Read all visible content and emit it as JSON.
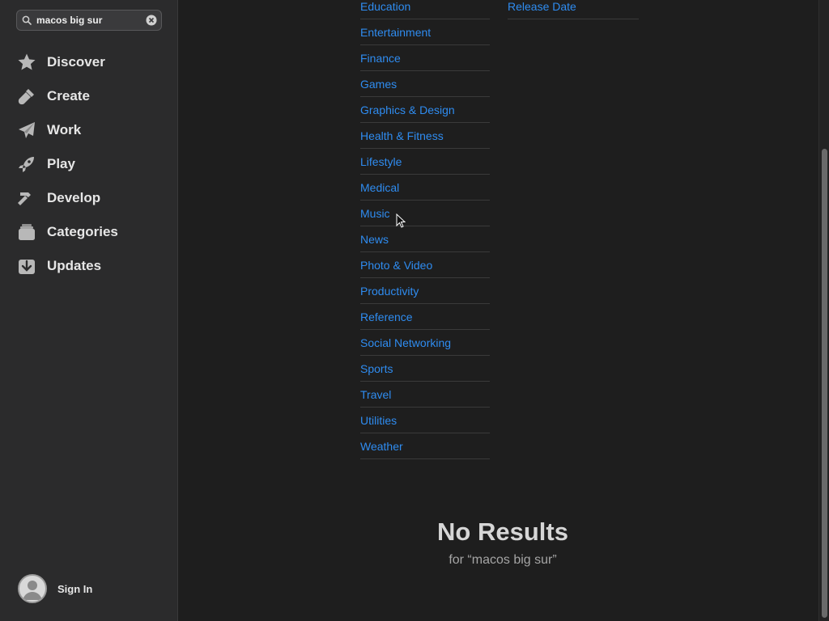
{
  "search": {
    "value": "macos big sur"
  },
  "sidebar": {
    "items": [
      {
        "label": "Discover",
        "icon": "star-icon"
      },
      {
        "label": "Create",
        "icon": "brush-icon"
      },
      {
        "label": "Work",
        "icon": "paper-plane-icon"
      },
      {
        "label": "Play",
        "icon": "rocket-icon"
      },
      {
        "label": "Develop",
        "icon": "hammer-icon"
      },
      {
        "label": "Categories",
        "icon": "stack-icon"
      },
      {
        "label": "Updates",
        "icon": "download-icon"
      }
    ],
    "signin_label": "Sign In"
  },
  "categories": {
    "column1": [
      "Education",
      "Entertainment",
      "Finance",
      "Games",
      "Graphics & Design",
      "Health & Fitness",
      "Lifestyle",
      "Medical",
      "Music",
      "News",
      "Photo & Video",
      "Productivity",
      "Reference",
      "Social Networking",
      "Sports",
      "Travel",
      "Utilities",
      "Weather"
    ],
    "column2": [
      "Release Date"
    ]
  },
  "results": {
    "title": "No Results",
    "subtitle": "for “macos big sur”"
  },
  "colors": {
    "link": "#2f8cf0",
    "sidebar_bg": "#2b2b2c",
    "main_bg": "#1e1e1e"
  }
}
